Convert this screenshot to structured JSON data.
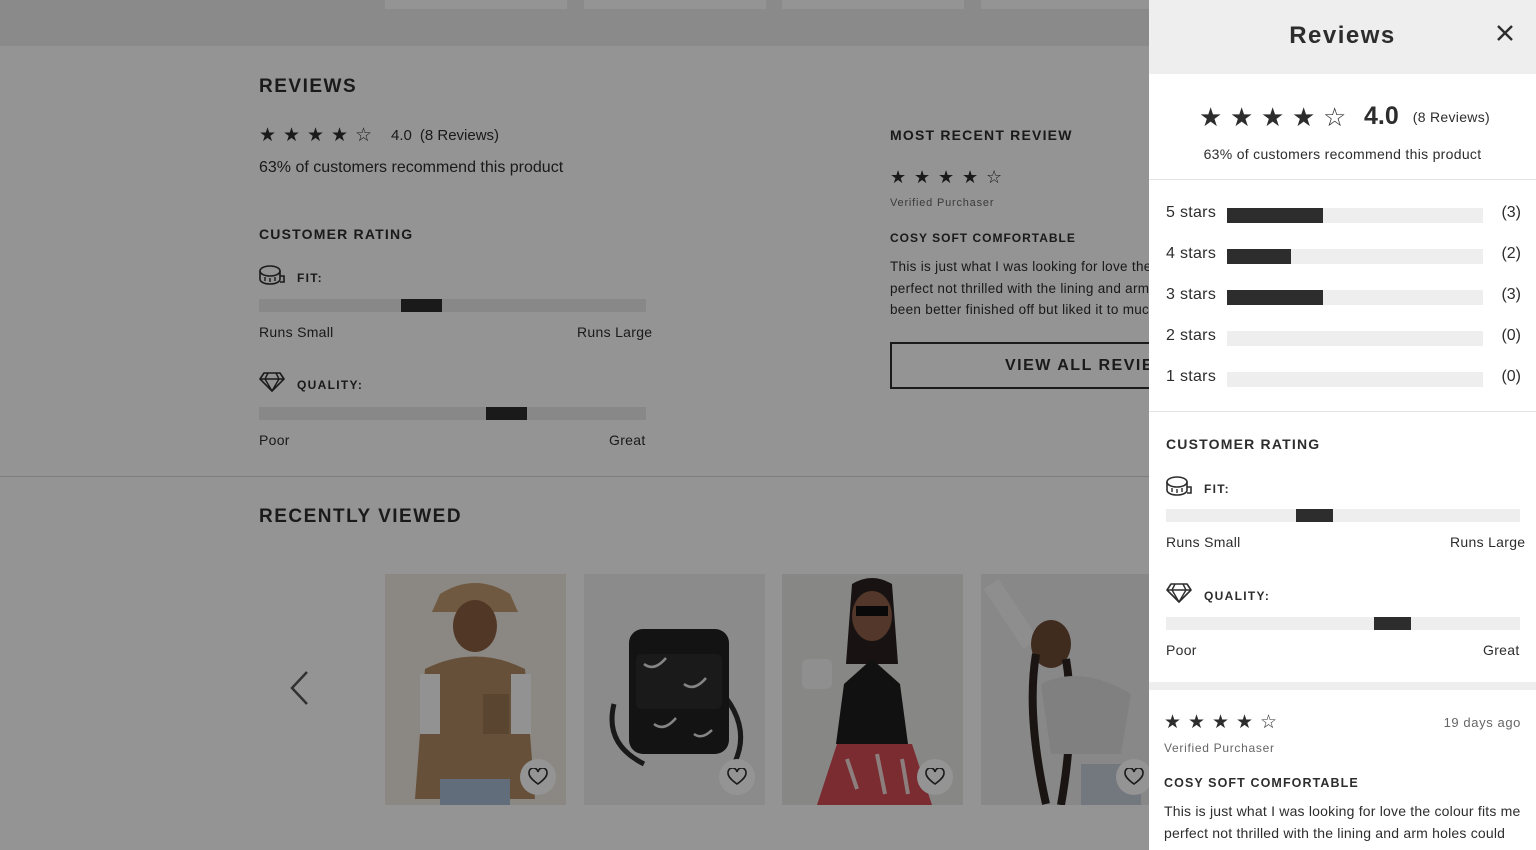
{
  "page": {
    "reviews_heading": "REVIEWS",
    "summary": {
      "rating": "4.0",
      "count_label": "(8 Reviews)",
      "stars_filled": 4,
      "stars_total": 5
    },
    "recommend_text": "63% of customers recommend this product",
    "customer_rating": {
      "title": "CUSTOMER RATING",
      "fit": {
        "label": "FIT:",
        "left": "Runs Small",
        "right": "Runs Large",
        "value": 0.42
      },
      "quality": {
        "label": "QUALITY:",
        "left": "Poor",
        "right": "Great",
        "value": 0.64
      }
    },
    "most_recent": {
      "title": "MOST RECENT REVIEW",
      "stars_filled": 4,
      "verified": "Verified Purchaser",
      "headline": "COSY SOFT COMFORTABLE",
      "body_lines": [
        "This is just what I was looking for love the colour fits me",
        "perfect not thrilled with the lining and arm holes could",
        "been better finished off but liked it to much to return"
      ],
      "view_all_label": "VIEW ALL REVIEWS"
    },
    "recently_viewed": {
      "title": "RECENTLY VIEWED",
      "prev_icon": "chevron-left-icon",
      "products": [
        {
          "name": "fleece-gilet-bucket-hat",
          "fav_icon": "heart-icon"
        },
        {
          "name": "black-crossbody-bag",
          "fav_icon": "heart-icon"
        },
        {
          "name": "black-halter-top",
          "fav_icon": "heart-icon"
        },
        {
          "name": "grey-cropped-cardigan",
          "fav_icon": "heart-icon"
        }
      ]
    }
  },
  "drawer": {
    "title": "Reviews",
    "close_icon": "close-icon",
    "summary": {
      "rating": "4.0",
      "count_label": "(8 Reviews)",
      "stars_filled": 4
    },
    "recommend_text": "63% of customers recommend this product",
    "histogram": [
      {
        "label": "5 stars",
        "count": "(3)",
        "value": 3,
        "max": 8
      },
      {
        "label": "4 stars",
        "count": "(2)",
        "value": 2,
        "max": 8
      },
      {
        "label": "3 stars",
        "count": "(3)",
        "value": 3,
        "max": 8
      },
      {
        "label": "2 stars",
        "count": "(0)",
        "value": 0,
        "max": 8
      },
      {
        "label": "1 stars",
        "count": "(0)",
        "value": 0,
        "max": 8
      }
    ],
    "customer_rating": {
      "title": "CUSTOMER RATING",
      "fit": {
        "label": "FIT:",
        "left": "Runs Small",
        "right": "Runs Large",
        "value": 0.42
      },
      "quality": {
        "label": "QUALITY:",
        "left": "Poor",
        "right": "Great",
        "value": 0.64
      }
    },
    "review": {
      "stars_filled": 4,
      "age": "19 days ago",
      "verified": "Verified Purchaser",
      "headline": "COSY SOFT COMFORTABLE",
      "body": "This is just what I was looking for love the colour fits me perfect not thrilled with the lining and arm holes could"
    }
  },
  "colors": {
    "ink": "#2d2d2d",
    "track": "#eeeeee",
    "overlay": "rgba(0,0,0,0.42)",
    "header": "#eeeeee"
  }
}
